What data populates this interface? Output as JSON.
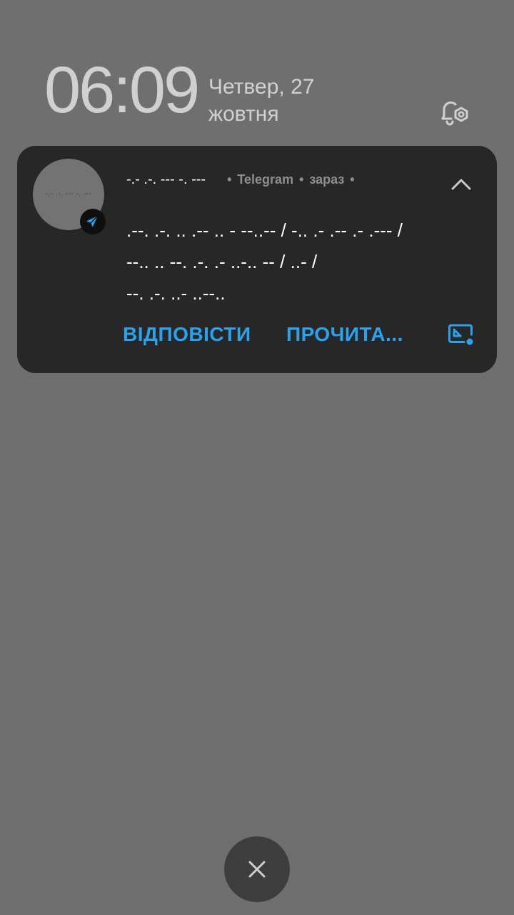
{
  "lockscreen": {
    "time": "06:09",
    "date_line1": "Четвер, 27",
    "date_line2": "жовтня",
    "notification_settings_icon": "bell-settings-icon"
  },
  "notification": {
    "avatar_text": "-.- .-. --- -. ---",
    "app_badge_icon": "telegram-icon",
    "sender": "-.- .-. --- -. ---",
    "app_name": "Telegram",
    "time": "зараз",
    "separator": "•",
    "collapse_icon": "chevron-up-icon",
    "message_lines": [
      ".--. .-. .. .-- .. - --..-- / -.. .- .-- .- .--- /",
      "--.. .. --. .-. .- ..-.. -- / ..- /",
      "--. .-. ..- ..--.."
    ],
    "actions": {
      "reply": "ВІДПОВІСТИ",
      "mark_read": "ПРОЧИТА..."
    },
    "pip_icon": "picture-in-picture-icon",
    "accent_color": "#2aa3ef"
  },
  "dismiss": {
    "icon": "close-icon"
  }
}
